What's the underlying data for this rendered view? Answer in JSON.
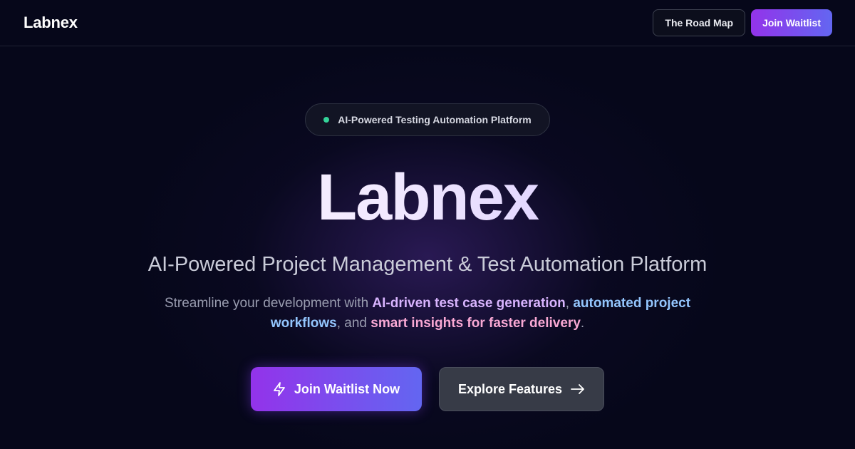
{
  "header": {
    "logo": "Labnex",
    "roadmap_label": "The Road Map",
    "waitlist_label": "Join Waitlist"
  },
  "hero": {
    "badge_text": "AI-Powered Testing Automation Platform",
    "title": "Labnex",
    "subtitle": "AI-Powered Project Management & Test Automation Platform",
    "description": {
      "part1": "Streamline your development with ",
      "highlight1": "AI-driven test case generation",
      "part2": ", ",
      "highlight2": "automated project workflows",
      "part3": ", and ",
      "highlight3": "smart insights for faster delivery",
      "part4": "."
    },
    "cta_primary_label": "Join Waitlist Now",
    "cta_primary_icon": "lightning-icon",
    "cta_secondary_label": "Explore Features",
    "cta_secondary_icon": "arrow-right-icon"
  },
  "colors": {
    "background": "#06071a",
    "accent_start": "#9333ea",
    "accent_end": "#6366f1",
    "status_dot": "#34d399",
    "highlight_purple": "#d8b4fe",
    "highlight_blue": "#93c5fd",
    "highlight_pink": "#f9a8d4"
  }
}
